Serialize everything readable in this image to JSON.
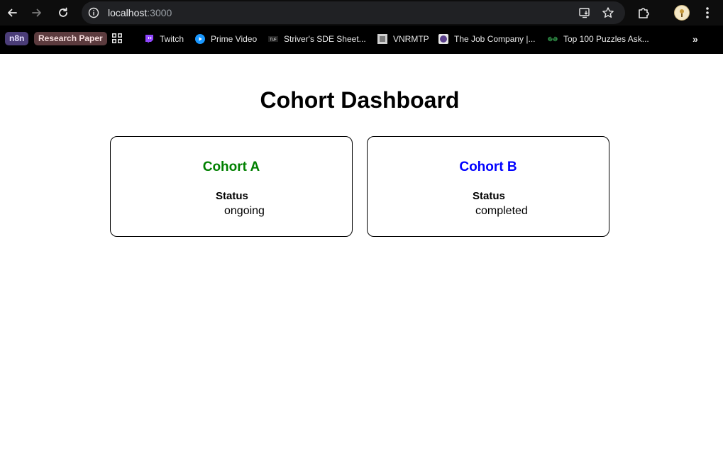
{
  "browser": {
    "url_host": "localhost",
    "url_port": ":3000",
    "bookmarks": {
      "chip_n8n": "n8n",
      "chip_research": "Research Paper",
      "items": [
        {
          "label": "Twitch",
          "icon": "twitch-icon",
          "color": "#9146ff"
        },
        {
          "label": "Prime Video",
          "icon": "prime-video-icon",
          "color": "#1a98ff"
        },
        {
          "label": "Striver's SDE Sheet...",
          "icon": "tuf-icon",
          "color": "#222222"
        },
        {
          "label": "VNRMTP",
          "icon": "vnrmtp-icon",
          "color": "#cccccc"
        },
        {
          "label": "The Job Company |...",
          "icon": "job-company-icon",
          "color": "#5a3f8a"
        },
        {
          "label": "Top 100 Puzzles Ask...",
          "icon": "geeksforgeeks-icon",
          "color": "#2f8d46"
        }
      ]
    }
  },
  "page": {
    "title": "Cohort Dashboard",
    "cohorts": [
      {
        "name": "Cohort A",
        "name_color": "#008000",
        "status_label": "Status",
        "status": "ongoing"
      },
      {
        "name": "Cohort B",
        "name_color": "#0000ff",
        "status_label": "Status",
        "status": "completed"
      }
    ]
  }
}
